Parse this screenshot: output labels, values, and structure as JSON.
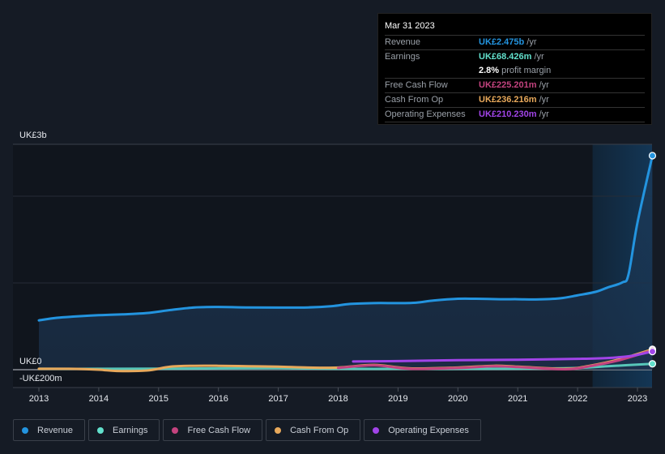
{
  "tooltip": {
    "date": "Mar 31 2023",
    "rows": [
      {
        "label": "Revenue",
        "value": "UK£2.475b",
        "unit": "/yr",
        "color": "#2394df"
      },
      {
        "label": "Earnings",
        "value": "UK£68.426m",
        "unit": "/yr",
        "color": "#62e0cc"
      },
      {
        "label": "",
        "value": "2.8%",
        "unit": "profit margin",
        "color": "#ffffff"
      },
      {
        "label": "Free Cash Flow",
        "value": "UK£225.201m",
        "unit": "/yr",
        "color": "#c4437f"
      },
      {
        "label": "Cash From Op",
        "value": "UK£236.216m",
        "unit": "/yr",
        "color": "#e8a95b"
      },
      {
        "label": "Operating Expenses",
        "value": "UK£210.230m",
        "unit": "/yr",
        "color": "#a144e8"
      }
    ]
  },
  "legend": [
    {
      "label": "Revenue",
      "color": "#2394df"
    },
    {
      "label": "Earnings",
      "color": "#62e0cc"
    },
    {
      "label": "Free Cash Flow",
      "color": "#c4437f"
    },
    {
      "label": "Cash From Op",
      "color": "#e8a95b"
    },
    {
      "label": "Operating Expenses",
      "color": "#a144e8"
    }
  ],
  "chart_data": {
    "type": "line",
    "title": "",
    "xlabel": "",
    "ylabel": "",
    "y_top_label": "UK£3b",
    "y_zero_label": "UK£0",
    "y_bottom_label": "-UK£200m",
    "ylim": [
      -200,
      2500
    ],
    "y_unit": "UK£m",
    "xlim": [
      2012.65,
      2023.25
    ],
    "x_ticks": [
      2013,
      2014,
      2015,
      2016,
      2017,
      2018,
      2019,
      2020,
      2021,
      2022,
      2023
    ],
    "x_tick_labels": [
      "2013",
      "2014",
      "2015",
      "2016",
      "2017",
      "2018",
      "2019",
      "2020",
      "2021",
      "2022",
      "2023"
    ],
    "highlight_range": [
      2022.25,
      2023.25
    ],
    "grid": true,
    "series": [
      {
        "name": "Revenue",
        "color": "#2394df",
        "x": [
          2013.0,
          2013.3,
          2013.6,
          2014.0,
          2014.4,
          2014.8,
          2015.2,
          2015.6,
          2016.0,
          2016.5,
          2017.0,
          2017.5,
          2017.9,
          2018.2,
          2018.6,
          2019.0,
          2019.3,
          2019.6,
          2020.0,
          2020.3,
          2020.7,
          2021.0,
          2021.3,
          2021.7,
          2022.0,
          2022.3,
          2022.5,
          2022.75,
          2022.85,
          2023.0,
          2023.25
        ],
        "y": [
          570,
          600,
          615,
          630,
          640,
          655,
          690,
          720,
          725,
          720,
          718,
          720,
          735,
          760,
          770,
          770,
          775,
          800,
          820,
          820,
          815,
          815,
          812,
          825,
          860,
          900,
          950,
          1010,
          1100,
          1700,
          2475
        ]
      },
      {
        "name": "Earnings",
        "color": "#62e0cc",
        "x": [
          2013.0,
          2014.0,
          2015.0,
          2016.0,
          2017.0,
          2017.3,
          2018.0,
          2019.0,
          2020.0,
          2021.0,
          2022.0,
          2022.5,
          2023.25
        ],
        "y": [
          10,
          10,
          12,
          15,
          18,
          15,
          10,
          10,
          10,
          12,
          20,
          40,
          68
        ]
      },
      {
        "name": "Free Cash Flow",
        "color": "#c4437f",
        "x": [
          2018.0,
          2018.6,
          2019.2,
          2020.0,
          2020.6,
          2021.0,
          2021.8,
          2022.2,
          2022.7,
          2023.25
        ],
        "y": [
          20,
          50,
          10,
          20,
          40,
          30,
          5,
          40,
          110,
          225
        ]
      },
      {
        "name": "Cash From Op",
        "color": "#e8a95b",
        "x": [
          2013.0,
          2013.5,
          2014.0,
          2014.3,
          2014.8,
          2015.2,
          2015.6,
          2016.0,
          2016.5,
          2017.0,
          2017.5,
          2018.0,
          2018.6,
          2019.2,
          2020.0,
          2020.6,
          2021.0,
          2021.8,
          2022.2,
          2022.7,
          2023.25
        ],
        "y": [
          10,
          10,
          0,
          -15,
          -10,
          35,
          45,
          45,
          40,
          35,
          25,
          25,
          55,
          15,
          25,
          45,
          35,
          10,
          45,
          120,
          236
        ]
      },
      {
        "name": "Operating Expenses",
        "color": "#a144e8",
        "x": [
          2018.25,
          2019.0,
          2020.0,
          2021.0,
          2022.0,
          2022.5,
          2022.9,
          2023.25
        ],
        "y": [
          95,
          100,
          110,
          115,
          125,
          135,
          160,
          210
        ]
      }
    ]
  }
}
